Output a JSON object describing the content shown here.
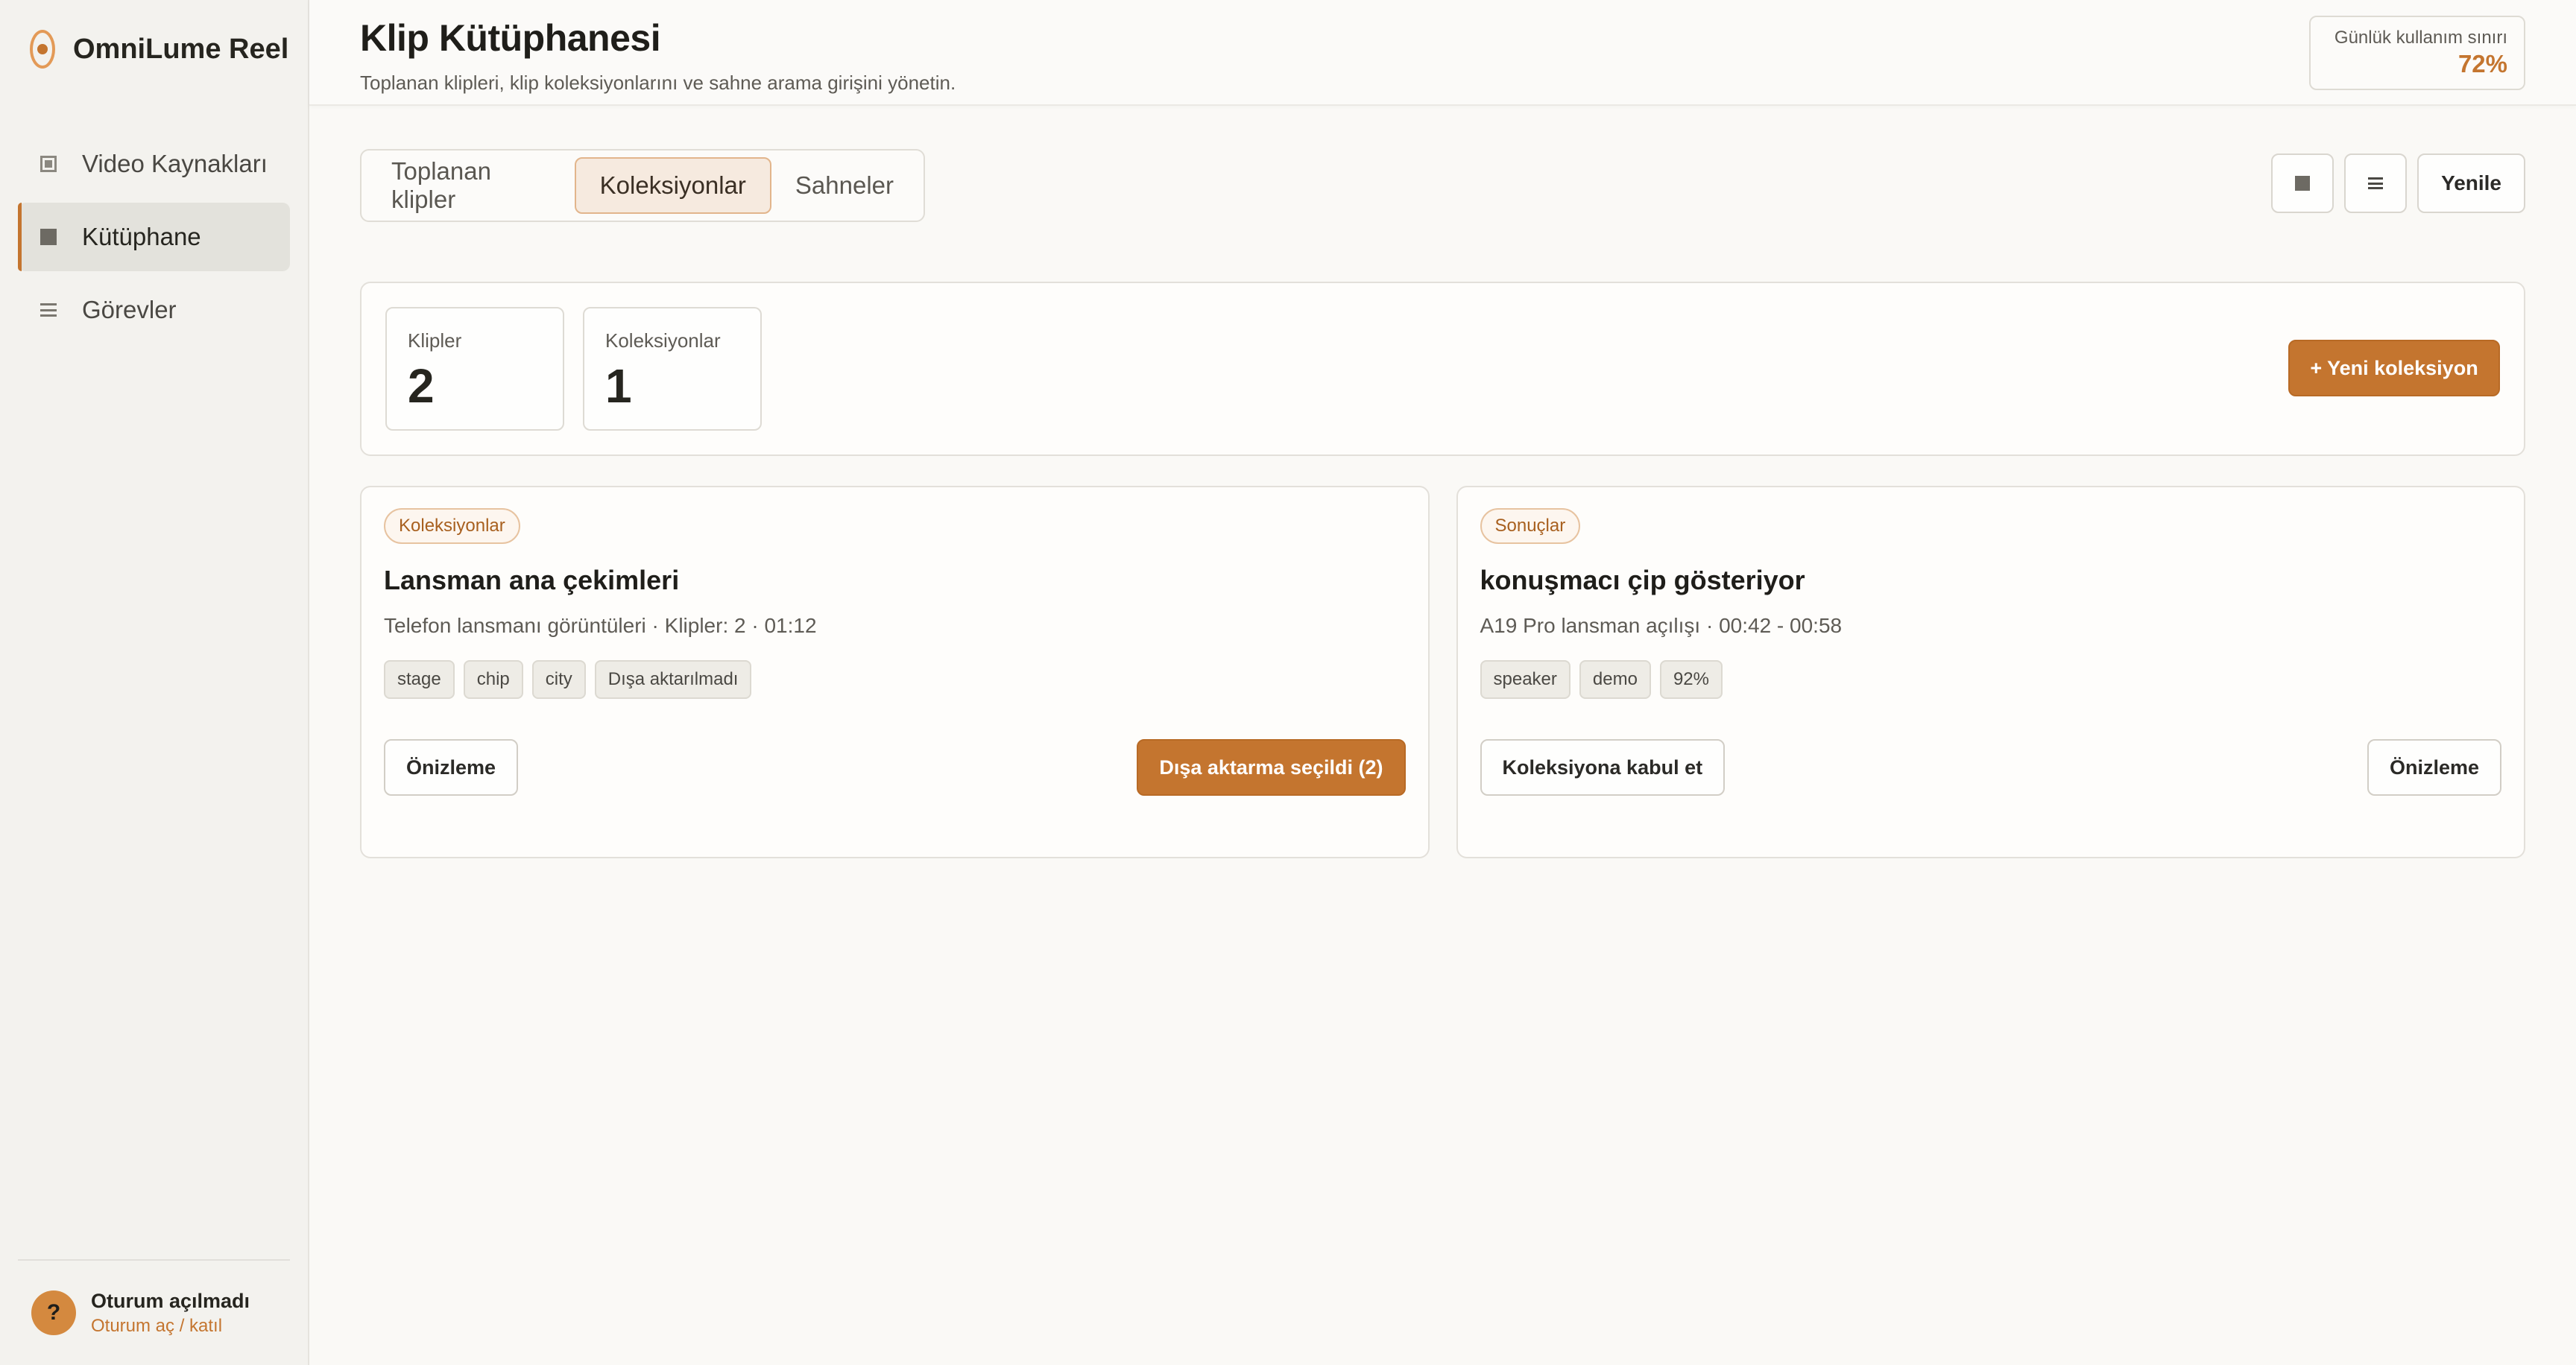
{
  "brand": {
    "name": "OmniLume Reel"
  },
  "sidebar": {
    "items": [
      {
        "label": "Video Kaynakları",
        "icon": "video-source-icon",
        "active": false
      },
      {
        "label": "Kütüphane",
        "icon": "library-icon",
        "active": true
      },
      {
        "label": "Görevler",
        "icon": "tasks-list-icon",
        "active": false
      }
    ],
    "session": {
      "avatar": "?",
      "title": "Oturum açılmadı",
      "link": "Oturum aç / katıl"
    }
  },
  "header": {
    "title": "Klip Kütüphanesi",
    "subtitle": "Toplanan klipleri, klip koleksiyonlarını ve sahne arama girişini yönetin.",
    "usage": {
      "label": "Günlük kullanım sınırı",
      "value": "72%"
    }
  },
  "tabs": [
    {
      "label": "Toplanan klipler",
      "active": false
    },
    {
      "label": "Koleksiyonlar",
      "active": true
    },
    {
      "label": "Sahneler",
      "active": false
    }
  ],
  "toolbar": {
    "refresh_label": "Yenile"
  },
  "stats": {
    "clips": {
      "label": "Klipler",
      "value": "2"
    },
    "collections": {
      "label": "Koleksiyonlar",
      "value": "1"
    },
    "new_collection_label": "+ Yeni koleksiyon"
  },
  "collection_card": {
    "badge": "Koleksiyonlar",
    "title": "Lansman ana çekimleri",
    "meta": "Telefon lansmanı görüntüleri · Klipler: 2 · 01:12",
    "tags": [
      "stage",
      "chip",
      "city",
      "Dışa aktarılmadı"
    ],
    "preview_label": "Önizleme",
    "export_label": "Dışa aktarma seçildi (2)"
  },
  "result_card": {
    "badge": "Sonuçlar",
    "title": "konuşmacı çip gösteriyor",
    "meta": "A19 Pro lansman açılışı · 00:42 - 00:58",
    "tags": [
      "speaker",
      "demo",
      "92%"
    ],
    "accept_label": "Koleksiyona kabul et",
    "preview_label": "Önizleme"
  },
  "colors": {
    "accent": "#c4752f",
    "background": "#faf9f6",
    "sidebar": "#f3f2ee"
  }
}
